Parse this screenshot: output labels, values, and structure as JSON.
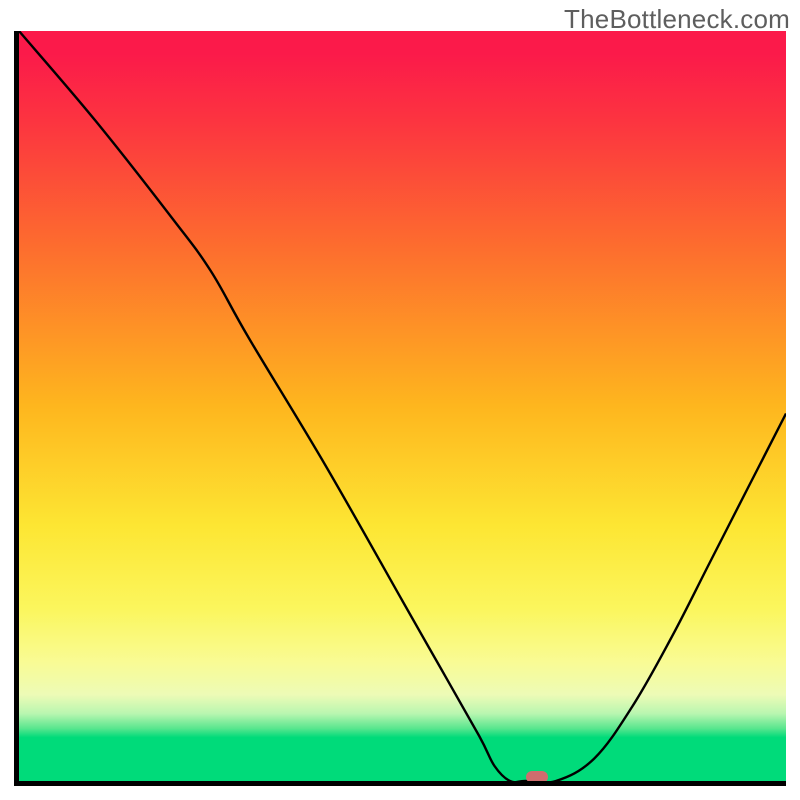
{
  "watermark": "TheBottleneck.com",
  "colors": {
    "curve": "#000000",
    "marker": "#cf6d6e",
    "axis": "#000000"
  },
  "chart_data": {
    "type": "line",
    "title": "",
    "xlabel": "",
    "ylabel": "",
    "xlim": [
      0,
      100
    ],
    "ylim": [
      0,
      100
    ],
    "grid": false,
    "series": [
      {
        "name": "bottleneck-curve",
        "x": [
          0,
          10,
          20,
          25,
          30,
          40,
          50,
          55,
          60,
          62,
          64,
          66,
          70,
          75,
          80,
          85,
          90,
          95,
          100
        ],
        "y": [
          100,
          88,
          75,
          68,
          59,
          42,
          24,
          15,
          6,
          2,
          0,
          0,
          0,
          3,
          10,
          19,
          29,
          39,
          49
        ]
      }
    ],
    "annotations": [
      {
        "name": "optimal-marker",
        "x": 67.5,
        "y": 0
      }
    ],
    "background_gradient_stops": [
      {
        "pos": 0.0,
        "color": "#fb1a4a"
      },
      {
        "pos": 0.5,
        "color": "#feb61e"
      },
      {
        "pos": 0.78,
        "color": "#f9fb93"
      },
      {
        "pos": 0.92,
        "color": "#58e68e"
      },
      {
        "pos": 1.0,
        "color": "#00db7a"
      }
    ]
  }
}
